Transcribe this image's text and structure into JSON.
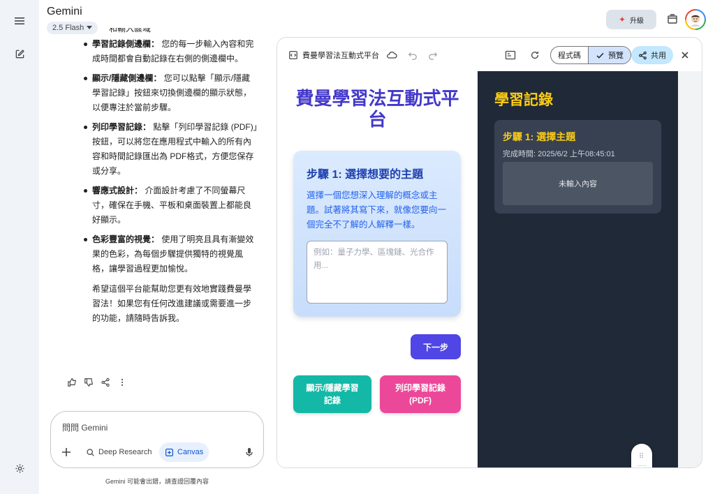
{
  "app": {
    "title": "Gemini",
    "model": "2.5 Flash"
  },
  "header": {
    "upgrade_label": "升級"
  },
  "chat": {
    "top_cut": "和輸入區域",
    "items": [
      {
        "title": "學習記錄側邊欄：",
        "text": "您的每一步輸入內容和完成時間都會自動記錄在右側的側邊欄中。"
      },
      {
        "title": "顯示/隱藏側邊欄：",
        "text": "您可以點擊「顯示/隱藏學習記錄」按鈕來切換側邊欄的顯示狀態，以便專注於當前步驟。"
      },
      {
        "title": "列印學習記錄：",
        "text": "點擊「列印學習記錄 (PDF)」按鈕，可以將您在應用程式中輸入的所有內容和時間記錄匯出為 PDF格式，方便您保存或分享。"
      },
      {
        "title": "響應式設計：",
        "text": "介面設計考慮了不同螢幕尺寸，確保在手機、平板和桌面裝置上都能良好顯示。"
      },
      {
        "title": "色彩豐富的視覺：",
        "text": "使用了明亮且具有漸變效果的色彩，為每個步驟提供獨特的視覺風格，讓學習過程更加愉悅。"
      }
    ],
    "closing": "希望這個平台能幫助您更有效地實踐費曼學習法！如果您有任何改進建議或需要進一步的功能，請隨時告訴我。"
  },
  "input": {
    "placeholder": "問問 Gemini",
    "deep_research": "Deep Research",
    "canvas": "Canvas",
    "disclaimer": "Gemini 可能會出錯，請查證回覆內容"
  },
  "canvas": {
    "doc_title": "費曼學習法互動式平台",
    "code_label": "程式碼",
    "preview_label": "預覽",
    "share_label": "共用"
  },
  "preview": {
    "app_title": "費曼學習法互動式平台",
    "step_title": "步驟 1: 選擇想要的主題",
    "step_desc": "選擇一個您想深入理解的概念或主題。試著將其寫下來，就像您要向一個完全不了解的人解釋一樣。",
    "textarea_placeholder": "例如：量子力學、區塊鏈、光合作用...",
    "next_button": "下一步",
    "toggle_button": "顯示/隱藏學習記錄",
    "print_button": "列印學習記錄 (PDF)"
  },
  "log": {
    "title": "學習記錄",
    "step": "步驟 1: 選擇主題",
    "time": "完成時間: 2025/6/2 上午08:45:01",
    "content": "未輸入內容"
  },
  "colors": {
    "app_title": "#4338ca",
    "step_card": "#dbeafe",
    "next_button": "#4f46e5",
    "toggle_button": "#14b8a6",
    "print_button": "#ec4899",
    "sidebar_bg": "#1f2937",
    "log_accent": "#facc15"
  }
}
